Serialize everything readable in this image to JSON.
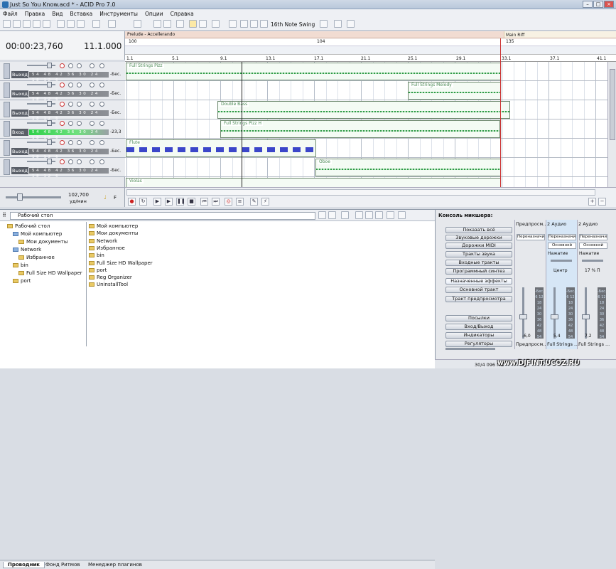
{
  "window": {
    "title": "Just So You Know.acd * - ACID Pro 7.0"
  },
  "menu": [
    "Файл",
    "Правка",
    "Вид",
    "Вставка",
    "Инструменты",
    "Опции",
    "Справка"
  ],
  "toolbar": {
    "swing": "16th Note Swing"
  },
  "time": {
    "timecode": "00:00:23,760",
    "beat": "11.1.000"
  },
  "markers": {
    "region1": "Prelude - Accellerando",
    "region2": "Main Riff"
  },
  "tempo": {
    "t1": "100",
    "t2": "104",
    "t3": "135"
  },
  "ruler": [
    "1.1",
    "5.1",
    "9.1",
    "13.1",
    "17.1",
    "21.1",
    "25.1",
    "29.1",
    "33.1",
    "37.1",
    "41.1"
  ],
  "tracks": [
    {
      "io": "Выход",
      "db": "-Бес.",
      "meter": "54 48 42 36 30 24 18 12 6"
    },
    {
      "io": "Выход",
      "db": "-Бес.",
      "meter": "54 48 42 36 30 24 18 12 6"
    },
    {
      "io": "Выход",
      "db": "-Бес.",
      "meter": "54 48 42 36 30 24 18 12 6"
    },
    {
      "io": "Вход",
      "db": "-23,3",
      "meter": "54 48 42 36 30 24 18 12 6"
    },
    {
      "io": "Выход",
      "db": "-Бес.",
      "meter": "54 48 42 36 30 24 18 12 6"
    },
    {
      "io": "Выход",
      "db": "-Бес.",
      "meter": "54 48 42 36 30 24 18 12 6"
    }
  ],
  "clips": {
    "c1": "Full Strings Pizz",
    "c2": "Full Strings Melody",
    "c3": "Double Bass",
    "c4": "Full Strings Pizz H",
    "c5": "Flute",
    "c6": "Oboe",
    "c7": "Violas"
  },
  "bpm": {
    "value": "102,700",
    "unit": "уд/мин",
    "f": "F"
  },
  "explorer": {
    "address": "Рабочий стол",
    "tree": [
      "Рабочий стол",
      "Мой компьютер",
      "Мои документы",
      "Network",
      "Избранное",
      "bin",
      "Full Size HD Wallpaper",
      "port"
    ],
    "files": [
      "Мой компьютер",
      "Мои документы",
      "Network",
      "Избранное",
      "bin",
      "Full Size HD Wallpaper",
      "port",
      "Reg Organizer",
      "UninstallTool"
    ],
    "tabs": [
      "Проводник",
      "Фонд Ритмов",
      "Менеджер плагинов"
    ]
  },
  "mixer": {
    "title": "Консоль микшера:",
    "buttons": [
      "Показать всё",
      "Звуковые дорожки",
      "Дорожки MIDI",
      "Тракты звука",
      "Входные тракты",
      "Программный синтез",
      "Назначенные эффекты",
      "Основной тракт",
      "Тракт предпросмотра",
      "Посылки",
      "Вход/Выход",
      "Индикаторы",
      "Регуляторы"
    ],
    "strips": [
      {
        "name": "Предпросм...",
        "route": "Переназначи...",
        "bottom": "Предпросм...",
        "val": "-6,0",
        "sub": ""
      },
      {
        "name": "2 Аудио",
        "route": "Переназначи...",
        "bottom": "Full Strings ...",
        "val": "5,4",
        "sub": "Основной",
        "press": "Нажатие",
        "center": "Центр"
      },
      {
        "name": "2 Аудио",
        "route": "Переназначи...",
        "bottom": "Full Strings ...",
        "val": "7,2",
        "sub": "Основной",
        "press": "Нажатие",
        "center": "17 % П"
      }
    ],
    "meter": "-Бес. 6 12 18 24 30 36 42 48 54"
  },
  "status": {
    "text": "30/4 096 МБ"
  },
  "watermark": "www.DJFINT.UCOZ.RU"
}
